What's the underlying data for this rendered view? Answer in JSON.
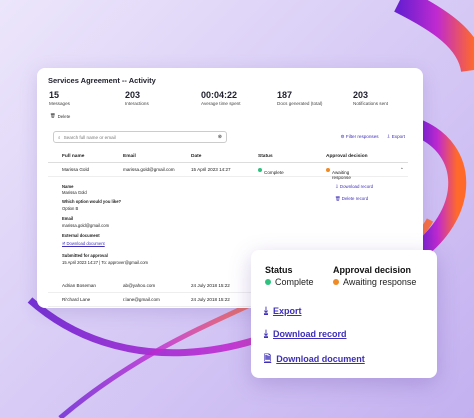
{
  "colors": {
    "accent": "#3d2fb8",
    "complete": "#2ec27e",
    "awaiting": "#f08a24"
  },
  "card": {
    "title": "Services Agreement -- Activity",
    "stats": [
      {
        "value": "15",
        "label": "Messages"
      },
      {
        "value": "203",
        "label": "Interactions"
      },
      {
        "value": "00:04:22",
        "label": "Average time spent"
      },
      {
        "value": "187",
        "label": "Docs generated (total)"
      },
      {
        "value": "203",
        "label": "Notifications sent"
      }
    ],
    "delete_label": "Delete",
    "search_placeholder": "Search full name or email",
    "filter_label": "Filter responses",
    "export_label": "Export",
    "columns": [
      "Full name",
      "Email",
      "Date",
      "Status",
      "Approval decision"
    ],
    "rows": [
      {
        "name": "Marissa Gold",
        "email": "marissa.gold@gmail.com",
        "date": "15 April 2023 14:27",
        "status": "Complete",
        "decision": "Awaiting response"
      },
      {
        "name": "Adrian Boseman",
        "email": "ab@yahoo.com",
        "date": "24 July 2018 15:22"
      },
      {
        "name": "Ri'chard Lane",
        "email": "r.lane@gmail.com",
        "date": "24 July 2018 15:22"
      }
    ],
    "detail": {
      "name_label": "Name",
      "name_value": "Marissa Gold",
      "option_label": "Which option would you like?",
      "option_value": "Option B",
      "email_label": "Email",
      "email_value": "marissa.gold@gmail.com",
      "ext_label": "External document",
      "ext_link": "Download document",
      "submitted_label": "Submitted for approval",
      "submitted_value": "15 April 2023 14:27 | To: approver@gmail.com",
      "download_record": "Download record",
      "delete_record": "Delete record"
    }
  },
  "overlay": {
    "status_label": "Status",
    "status_value": "Complete",
    "decision_label": "Approval decision",
    "decision_value": "Awaiting response",
    "export": "Export",
    "download_record": "Download record",
    "download_document": "Download document"
  }
}
